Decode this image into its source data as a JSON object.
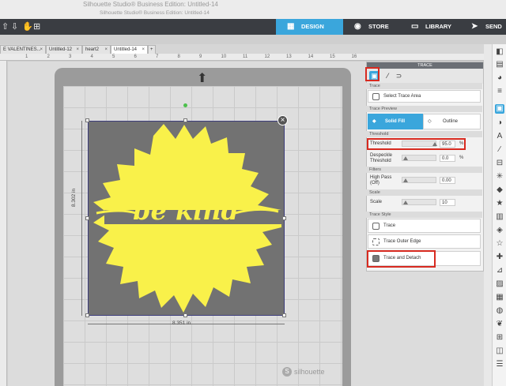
{
  "window": {
    "title": "Silhouette Studio® Business Edition: Untitled-14",
    "subtitle": "Silhouette Studio® Business Edition: Untitled-14"
  },
  "nav": {
    "design": "DESIGN",
    "store": "STORE",
    "library": "LIBRARY",
    "send": "SEND"
  },
  "tabs": [
    {
      "label": "E VALENTINES..."
    },
    {
      "label": "Untitled-12"
    },
    {
      "label": "heart2"
    },
    {
      "label": "Untitled-14"
    },
    {
      "label": "+"
    }
  ],
  "ruler_top": [
    "1",
    "2",
    "3",
    "4",
    "5",
    "6",
    "7",
    "8",
    "9",
    "10",
    "11",
    "12",
    "13",
    "14",
    "15",
    "16"
  ],
  "canvas": {
    "width_label": "8.351 in",
    "height_label": "8.302 in",
    "text": "be kind",
    "brand": "silhouette",
    "design_color": "#f9f14a"
  },
  "panel": {
    "title": "TRACE",
    "section_trace": "Trace",
    "select_trace_area": "Select Trace Area",
    "section_preview": "Trace Preview",
    "solid_fill": "Solid Fill",
    "outline": "Outline",
    "section_threshold": "Threshold",
    "threshold_label": "Threshold",
    "threshold_value": "95.0",
    "threshold_unit": "%",
    "despeckle_label": "Despeckle Threshold",
    "despeckle_value": "0.0",
    "despeckle_unit": "%",
    "section_filters": "Filters",
    "highpass_label": "High Pass (Off)",
    "highpass_value": "0.00",
    "section_scale": "Scale",
    "scale_label": "Scale",
    "scale_value": "10",
    "section_style": "Trace Style",
    "trace": "Trace",
    "trace_outer_edge": "Trace Outer Edge",
    "trace_and_detach": "Trace and Detach"
  },
  "colors": {
    "accent": "#3aa6dc",
    "highlight": "#d72a20"
  }
}
